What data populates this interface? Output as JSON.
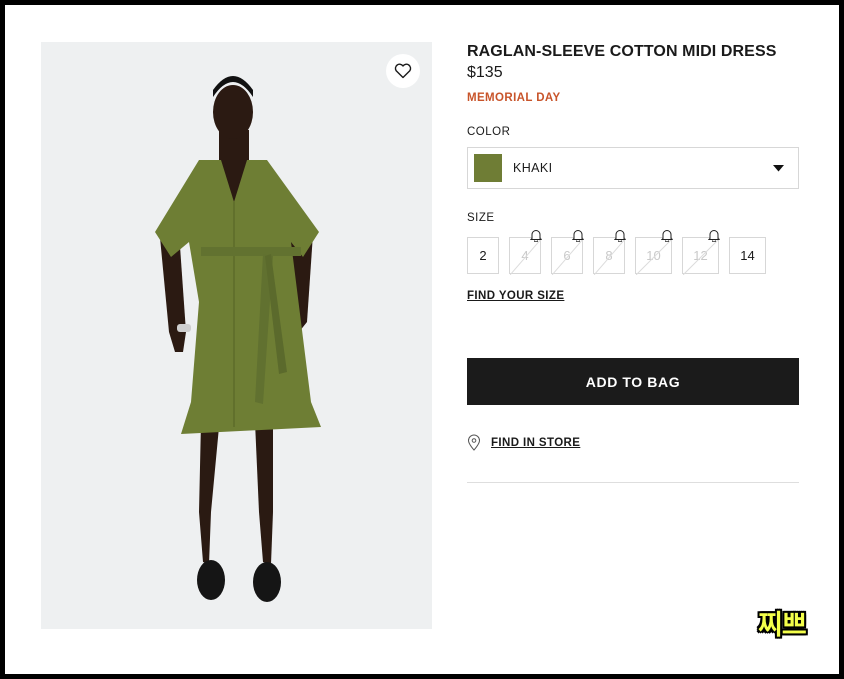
{
  "product": {
    "title": "RAGLAN-SLEEVE COTTON MIDI DRESS",
    "price": "$135",
    "promo": "MEMORIAL DAY",
    "promo_color": "#c8542a"
  },
  "color": {
    "label": "COLOR",
    "selected": "KHAKI",
    "swatch_hex": "#6f7d35"
  },
  "size": {
    "label": "SIZE",
    "options": [
      {
        "label": "2",
        "available": true
      },
      {
        "label": "4",
        "available": false
      },
      {
        "label": "6",
        "available": false
      },
      {
        "label": "8",
        "available": false
      },
      {
        "label": "10",
        "available": false
      },
      {
        "label": "12",
        "available": false
      },
      {
        "label": "14",
        "available": true
      }
    ],
    "find_size": "FIND YOUR SIZE"
  },
  "actions": {
    "add_to_bag": "ADD TO BAG",
    "find_in_store": "FIND IN STORE"
  },
  "icons": {
    "wishlist": "heart-icon",
    "store": "location-pin-icon",
    "dropdown": "caret-down-icon",
    "notify": "bell-icon"
  },
  "watermark": "찌쁘"
}
